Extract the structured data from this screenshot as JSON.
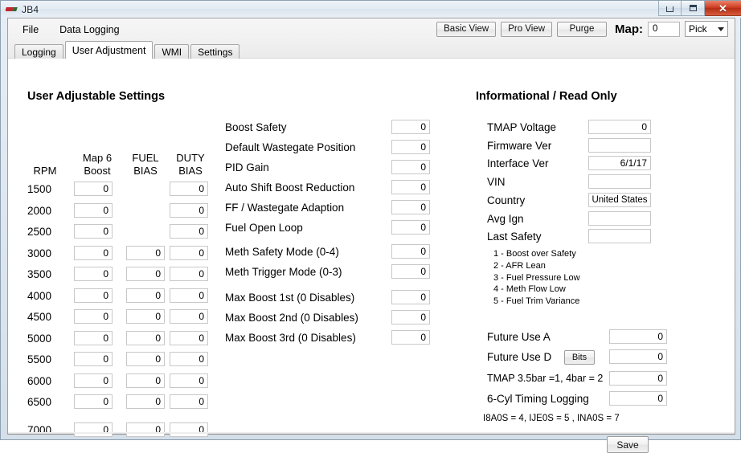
{
  "window": {
    "title": "JB4",
    "icon": "app-logo-icon",
    "controls": {
      "minimize": "–",
      "maximize": "□",
      "close": "✕"
    }
  },
  "menu": {
    "items": [
      "File",
      "Data Logging"
    ]
  },
  "toolbar": {
    "basic_view": "Basic View",
    "pro_view": "Pro View",
    "purge": "Purge",
    "map_label": "Map:",
    "map_value": "0",
    "pick_label": "Pick"
  },
  "tabs": [
    {
      "label": "Logging",
      "active": false
    },
    {
      "label": "User Adjustment",
      "active": true
    },
    {
      "label": "WMI",
      "active": false
    },
    {
      "label": "Settings",
      "active": false
    }
  ],
  "left_section": {
    "heading": "User Adjustable Settings",
    "columns": [
      "RPM",
      "Map 6 Boost",
      "FUEL BIAS",
      "DUTY BIAS"
    ],
    "column_lines": [
      [
        "RPM"
      ],
      [
        "Map 6",
        "Boost"
      ],
      [
        "FUEL",
        "BIAS"
      ],
      [
        "DUTY",
        "BIAS"
      ]
    ],
    "rows": [
      {
        "rpm": "1500",
        "boost": "0",
        "fuel_bias": null,
        "duty_bias": "0"
      },
      {
        "rpm": "2000",
        "boost": "0",
        "fuel_bias": null,
        "duty_bias": "0"
      },
      {
        "rpm": "2500",
        "boost": "0",
        "fuel_bias": null,
        "duty_bias": "0"
      },
      {
        "rpm": "3000",
        "boost": "0",
        "fuel_bias": "0",
        "duty_bias": "0"
      },
      {
        "rpm": "3500",
        "boost": "0",
        "fuel_bias": "0",
        "duty_bias": "0"
      },
      {
        "rpm": "4000",
        "boost": "0",
        "fuel_bias": "0",
        "duty_bias": "0"
      },
      {
        "rpm": "4500",
        "boost": "0",
        "fuel_bias": "0",
        "duty_bias": "0"
      },
      {
        "rpm": "5000",
        "boost": "0",
        "fuel_bias": "0",
        "duty_bias": "0"
      },
      {
        "rpm": "5500",
        "boost": "0",
        "fuel_bias": "0",
        "duty_bias": "0"
      },
      {
        "rpm": "6000",
        "boost": "0",
        "fuel_bias": "0",
        "duty_bias": "0"
      },
      {
        "rpm": "6500",
        "boost": "0",
        "fuel_bias": "0",
        "duty_bias": "0"
      },
      {
        "rpm": "7000",
        "boost": "0",
        "fuel_bias": "0",
        "duty_bias": "0"
      }
    ]
  },
  "middle_section": {
    "fields": [
      {
        "label": "Boost Safety",
        "value": "0"
      },
      {
        "label": "Default Wastegate Position",
        "value": "0"
      },
      {
        "label": "PID Gain",
        "value": "0"
      },
      {
        "label": "Auto Shift Boost Reduction",
        "value": "0"
      },
      {
        "label": "FF / Wastegate Adaption",
        "value": "0"
      },
      {
        "label": "Fuel Open Loop",
        "value": "0"
      },
      {
        "label": "Meth Safety Mode (0-4)",
        "value": "0"
      },
      {
        "label": "Meth Trigger Mode (0-3)",
        "value": "0"
      },
      {
        "label": "Max Boost 1st (0 Disables)",
        "value": "0"
      },
      {
        "label": "Max Boost 2nd (0 Disables)",
        "value": "0"
      },
      {
        "label": "Max Boost 3rd (0 Disables)",
        "value": "0"
      }
    ]
  },
  "right_section": {
    "heading": "Informational / Read Only",
    "fields": [
      {
        "label": "TMAP Voltage",
        "value": "0",
        "align": "right"
      },
      {
        "label": "Firmware Ver",
        "value": "",
        "align": "right"
      },
      {
        "label": "Interface Ver",
        "value": "6/1/17",
        "align": "right"
      },
      {
        "label": "VIN",
        "value": "",
        "align": "right"
      },
      {
        "label": "Country",
        "value": "United States",
        "align": "center"
      },
      {
        "label": "Avg Ign",
        "value": "",
        "align": "right"
      },
      {
        "label": "Last Safety",
        "value": "",
        "align": "right"
      }
    ],
    "safety_codes": [
      "1 - Boost over Safety",
      "2 - AFR Lean",
      "3 - Fuel Pressure Low",
      "4 - Meth Flow Low",
      "5 - Fuel Trim Variance"
    ],
    "future_fields": [
      {
        "label": "Future Use A",
        "value": "0",
        "button": null,
        "size": "large"
      },
      {
        "label": "Future Use D",
        "value": "0",
        "button": "Bits",
        "size": "large"
      },
      {
        "label": "TMAP 3.5bar =1, 4bar = 2",
        "value": "0",
        "button": null,
        "size": "small"
      },
      {
        "label": "6-Cyl Timing Logging",
        "value": "0",
        "button": null,
        "size": "large"
      }
    ],
    "footer_note": "I8A0S = 4, IJE0S = 5 , INA0S = 7"
  },
  "actions": {
    "save": "Save"
  }
}
